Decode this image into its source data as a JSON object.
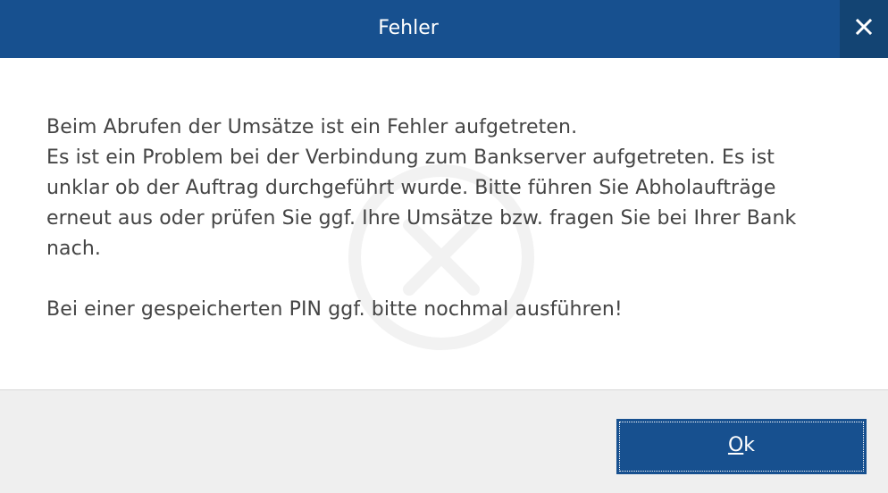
{
  "window": {
    "title": "Fehler",
    "close_icon": "close-icon"
  },
  "message": {
    "line1": "Beim Abrufen der Umsätze ist ein Fehler aufgetreten.",
    "body": "Es ist ein Problem bei der Verbindung zum Bankserver aufgetreten. Es ist unklar ob der Auftrag durchgeführt wurde. Bitte führen Sie Abholaufträge erneut aus oder prüfen Sie ggf. Ihre Umsätze bzw. fragen Sie bei Ihrer Bank nach.",
    "hint": "Bei einer gespeicherten PIN ggf. bitte nochmal ausführen!",
    "watermark_icon": "error-circle-icon"
  },
  "footer": {
    "ok_mnemonic": "O",
    "ok_rest": "k"
  },
  "colors": {
    "titlebar": "#17508f",
    "close_button": "#134473",
    "text": "#444444",
    "footer": "#efefef"
  }
}
